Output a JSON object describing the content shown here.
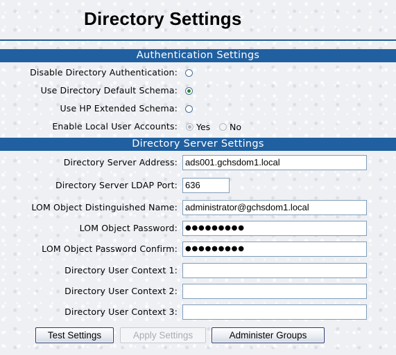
{
  "page_title": "Directory Settings",
  "auth_section": {
    "title": "Authentication Settings",
    "disable_directory_auth": {
      "label": "Disable Directory Authentication:",
      "checked": false
    },
    "default_schema": {
      "label": "Use Directory Default Schema:",
      "checked": true
    },
    "hp_extended_schema": {
      "label": "Use HP Extended Schema:",
      "checked": false
    },
    "local_user_accounts": {
      "label": "Enable Local User Accounts:",
      "yes_label": "Yes",
      "no_label": "No",
      "selected": "Yes",
      "disabled": true
    }
  },
  "server_section": {
    "title": "Directory Server Settings",
    "server_address": {
      "label": "Directory Server Address:",
      "value": "ads001.gchsdom1.local"
    },
    "ldap_port": {
      "label": "Directory Server LDAP Port:",
      "value": "636"
    },
    "lom_dn": {
      "label": "LOM Object Distinguished Name:",
      "value": "administrator@gchsdom1.local"
    },
    "lom_password": {
      "label": "LOM Object Password:",
      "value": "●●●●●●●●●"
    },
    "lom_password_confirm": {
      "label": "LOM Object Password Confirm:",
      "value": "●●●●●●●●●"
    },
    "user_context_1": {
      "label": "Directory User Context 1:",
      "value": ""
    },
    "user_context_2": {
      "label": "Directory User Context 2:",
      "value": ""
    },
    "user_context_3": {
      "label": "Directory User Context 3:",
      "value": ""
    }
  },
  "buttons": {
    "test_settings": "Test Settings",
    "apply_settings": "Apply Settings",
    "administer_groups": "Administer Groups"
  },
  "colors": {
    "section_bar": "#2060a0",
    "title_rule": "#1c5a95",
    "checked_radio": "#1e8a32"
  }
}
